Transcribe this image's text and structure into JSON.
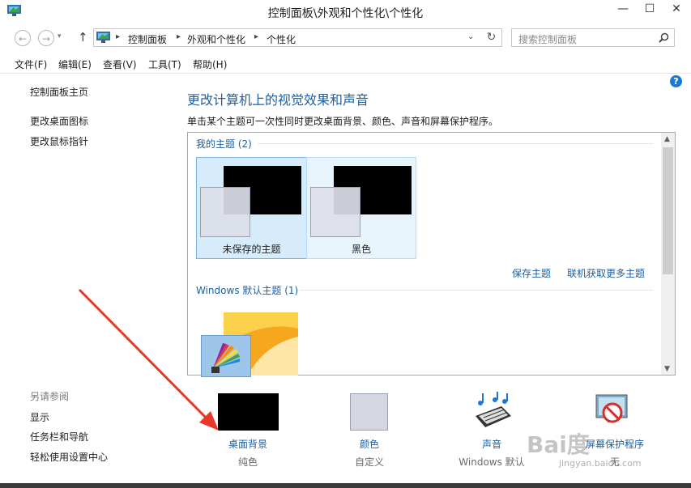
{
  "window": {
    "title": "控制面板\\外观和个性化\\个性化",
    "minimize": "—",
    "maximize": "☐",
    "close": "✕"
  },
  "address": {
    "crumbs": [
      "控制面板",
      "外观和个性化",
      "个性化"
    ],
    "search_placeholder": "搜索控制面板"
  },
  "menu": [
    "文件(F)",
    "编辑(E)",
    "查看(V)",
    "工具(T)",
    "帮助(H)"
  ],
  "left_pane": {
    "links": [
      "控制面板主页",
      "更改桌面图标",
      "更改鼠标指针"
    ],
    "see_also_heading": "另请参阅",
    "see_also": [
      "显示",
      "任务栏和导航",
      "轻松使用设置中心"
    ]
  },
  "main": {
    "title": "更改计算机上的视觉效果和声音",
    "description": "单击某个主题可一次性同时更改桌面背景、颜色、声音和屏幕保护程序。",
    "my_themes_label": "我的主题 (2)",
    "my_themes": [
      {
        "name": "未保存的主题",
        "selected": true
      },
      {
        "name": "黑色",
        "selected": false
      }
    ],
    "save_theme": "保存主题",
    "get_more": "联机获取更多主题",
    "windows_themes_label": "Windows 默认主题 (1)"
  },
  "bottom": [
    {
      "label": "桌面背景",
      "sub": "纯色"
    },
    {
      "label": "颜色",
      "sub": "自定义"
    },
    {
      "label": "声音",
      "sub": "Windows 默认"
    },
    {
      "label": "屏幕保护程序",
      "sub": "无"
    }
  ],
  "watermark": {
    "text": "Bai度",
    "sub": "jingyan.baidu.com"
  },
  "colors": {
    "accent": "#1e5e9e",
    "selection": "#d6ecfa",
    "arrow": "#e8372b"
  },
  "icons": [
    "control-panel-icon",
    "back-icon",
    "forward-icon",
    "up-arrow-icon",
    "refresh-icon",
    "search-icon",
    "help-icon",
    "dropdown-icon"
  ]
}
